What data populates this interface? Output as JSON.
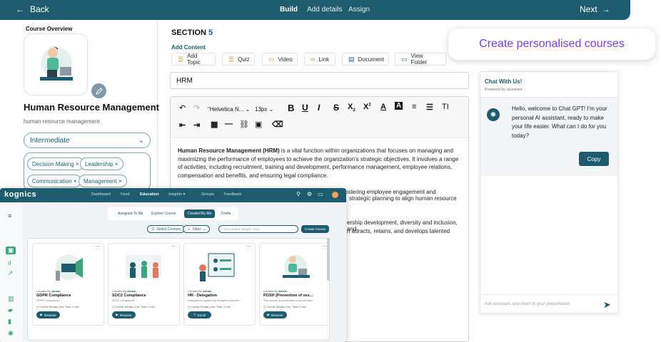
{
  "topbar": {
    "back_label": "Back",
    "back_icon": "arrow-left-icon",
    "tabs": [
      "Build",
      "Add details",
      "Assign"
    ],
    "active_tab": "Build",
    "next_label": "Next",
    "next_icon": "arrow-right-icon"
  },
  "left": {
    "overview_title": "Course Overview",
    "course_title": "Human Resource Management",
    "course_subtitle": "human resource management",
    "level": "Intermediate",
    "tags": [
      "Decision Making",
      "Leadership",
      "Communication",
      "Management"
    ]
  },
  "section": {
    "label": "SECTION",
    "number": "5"
  },
  "add_content": {
    "label": "Add Content",
    "buttons": [
      "Add Topic",
      "Quiz",
      "Video",
      "Link",
      "Document",
      "View Folder"
    ]
  },
  "topic_title_value": "HRM",
  "editor": {
    "font_family": "\"Helvetica N...",
    "font_size": "13px",
    "paragraph1_bold": "Human Resource Management (HRM)",
    "paragraph1_rest": " is a vital function within organizations that focuses on managing and maximizing the performance of employees to achieve the organization's strategic objectives. It involves a range of activities, including recruitment, training and development, performance management, employee relations, compensation and benefits, and ensuring legal compliance.",
    "paragraph2_line1": "HRM plays a crucial role in creating a positive work environment, fostering employee engagement and productivity,",
    "paragraph2_line2": "strategic planning to align human resource",
    "paragraph2_line3": "ership development, diversity and inclusion, and",
    "paragraph2_line4": "n attracts, retains, and develops talented"
  },
  "callout": "Create personalised courses",
  "chat": {
    "title": "Chat With Us!",
    "subtitle": "Powered by assistant",
    "message": "Hello, welcome to Chat GPT! I'm your personal AI assistant, ready to make your life easier. What can I do for you today?",
    "copy_label": "Copy",
    "input_placeholder": "Ask assistant, and insert in your presentation"
  },
  "app": {
    "logo": "kognics",
    "nav": [
      "Dashboard",
      "Feed",
      "Education",
      "Insights",
      "Groups",
      "Feedback"
    ],
    "active_nav": "Education",
    "tabs": [
      "Assigned To Me",
      "Explore Course",
      "Created By Me",
      "Drafts"
    ],
    "active_tab": "Created By Me",
    "select_courses": "Select Courses",
    "filter": "Filter",
    "search_placeholder": "Your Search Begins Here",
    "create_course": "Create Course",
    "cards": [
      {
        "created_by": "Created By",
        "author": "Admin",
        "title": "GDPR Compliance",
        "subtitle": "GDPR Compliance",
        "meta": "Course Details  |  Est. Time: 0 min",
        "action": "Resume"
      },
      {
        "created_by": "Created By",
        "author": "Admin",
        "title": "SOC2 Compliance",
        "subtitle": "SOC2 Compliance",
        "meta": "Course Details  |  Est. Time: 0 min",
        "action": "Resume"
      },
      {
        "created_by": "Created By",
        "author": "Admin",
        "title": "HR - Delegation",
        "subtitle": "Delegations explain this assigned responsi...",
        "meta": "Course Details  |  Est. Time: 0 min",
        "action": "Enroll"
      },
      {
        "created_by": "Created By",
        "author": "Admin",
        "title": "POSH (Prevention of sex...",
        "subtitle": "This course on prevention of sexual hara...",
        "meta": "Course Details  |  Est. Time: 0 min",
        "action": "Resume"
      }
    ]
  }
}
